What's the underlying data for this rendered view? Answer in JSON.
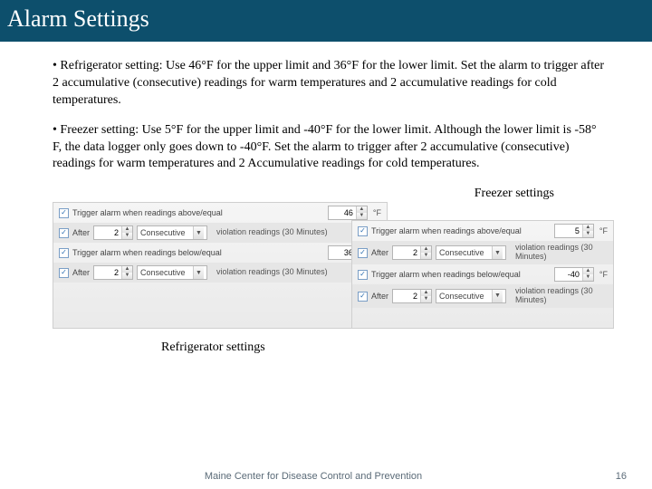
{
  "header": {
    "title": "Alarm Settings"
  },
  "body": {
    "p1": "• Refrigerator setting: Use 46°F for the upper limit and 36°F for the lower limit. Set the alarm to trigger after 2 accumulative (consecutive) readings for warm temperatures and 2 accumulative readings for cold temperatures.",
    "p2": "• Freezer setting: Use 5°F for the upper limit and -40°F for the lower limit. Although the lower limit is -58° F, the data logger only goes down to -40°F. Set the alarm to trigger after 2 accumulative (consecutive) readings for warm temperatures and 2 Accumulative readings for cold temperatures."
  },
  "labels": {
    "freezer": "Freezer settings",
    "refrigerator": "Refrigerator settings"
  },
  "ui": {
    "trigger_above": "Trigger alarm when readings above/equal",
    "trigger_below": "Trigger alarm when readings below/equal",
    "after": "After",
    "consecutive": "Consecutive",
    "violation": "violation readings (30 Minutes)",
    "unit": "°F"
  },
  "refrig": {
    "upper": "46",
    "upper_after": "2",
    "lower": "36",
    "lower_after": "2"
  },
  "freezer": {
    "upper": "5",
    "upper_after": "2",
    "lower": "-40",
    "lower_after": "2"
  },
  "footer": {
    "org": "Maine Center for Disease Control and Prevention",
    "page": "16"
  }
}
